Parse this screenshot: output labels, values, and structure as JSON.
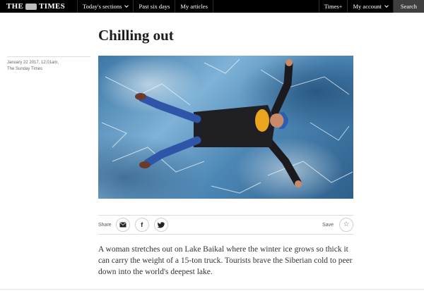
{
  "header": {
    "logo_left": "THE",
    "logo_right": "TIMES",
    "nav": [
      {
        "label": "Today's sections",
        "has_dropdown": true
      },
      {
        "label": "Past six days"
      },
      {
        "label": "My articles"
      }
    ],
    "times_plus": "Times+",
    "my_account": "My account",
    "search": "Search"
  },
  "article": {
    "title": "Chilling out",
    "date": "January 22 2017, 12:01am,",
    "source": "The Sunday Times",
    "caption": "A woman stretches out on Lake Baikal where the winter ice grows so thick it can carry the weight of a 15-ton truck. Tourists brave the Siberian cold to peer down into the world's deepest lake."
  },
  "sharebar": {
    "share_label": "Share",
    "save_label": "Save",
    "icons": [
      "email-icon",
      "facebook-icon",
      "twitter-icon",
      "star-icon"
    ]
  },
  "colors": {
    "topbar": "#000000",
    "search_bg": "#3f3f3f",
    "ice_blue": "#4d87b5"
  }
}
